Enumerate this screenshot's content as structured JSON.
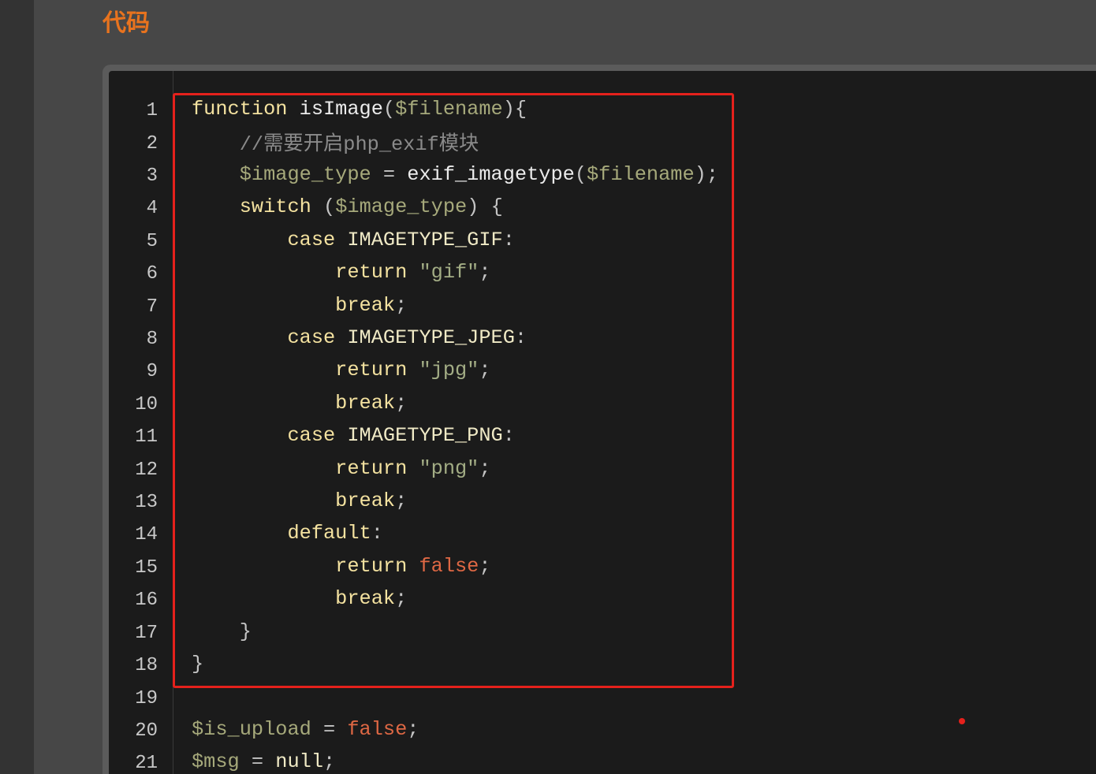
{
  "page": {
    "title": "代码"
  },
  "colors": {
    "title": "#e8731e",
    "highlight": "#e5211c",
    "marker": "#e5211c",
    "line_number": "#c8c8c8",
    "syntax": {
      "keyword": "#f4e2a0",
      "function": "#ececec",
      "variable": "#a6a97b",
      "comment": "#8a8a8a",
      "string": "#a3ad85",
      "constant": "#f0eac6",
      "boolean": "#df6844",
      "punctuation": "#c4c4c4"
    }
  },
  "code": {
    "lines": [
      {
        "num": "1",
        "tokens": [
          {
            "keyword": "function"
          },
          {
            "space": " "
          },
          {
            "function": "isImage"
          },
          {
            "punctuation": "("
          },
          {
            "variable": "$filename"
          },
          {
            "punctuation": "){"
          }
        ]
      },
      {
        "num": "2",
        "tokens": [
          {
            "space": "    "
          },
          {
            "comment": "//需要开启php_exif模块"
          }
        ]
      },
      {
        "num": "3",
        "tokens": [
          {
            "space": "    "
          },
          {
            "variable": "$image_type"
          },
          {
            "punctuation": " = "
          },
          {
            "function": "exif_imagetype"
          },
          {
            "punctuation": "("
          },
          {
            "variable": "$filename"
          },
          {
            "punctuation": ");"
          }
        ]
      },
      {
        "num": "4",
        "tokens": [
          {
            "space": "    "
          },
          {
            "keyword": "switch"
          },
          {
            "punctuation": " ("
          },
          {
            "variable": "$image_type"
          },
          {
            "punctuation": ") {"
          }
        ]
      },
      {
        "num": "5",
        "tokens": [
          {
            "space": "        "
          },
          {
            "keyword": "case"
          },
          {
            "space": " "
          },
          {
            "constant": "IMAGETYPE_GIF"
          },
          {
            "punctuation": ":"
          }
        ]
      },
      {
        "num": "6",
        "tokens": [
          {
            "space": "            "
          },
          {
            "keyword": "return"
          },
          {
            "space": " "
          },
          {
            "string": "\"gif\""
          },
          {
            "punctuation": ";"
          }
        ]
      },
      {
        "num": "7",
        "tokens": [
          {
            "space": "            "
          },
          {
            "keyword": "break"
          },
          {
            "punctuation": ";"
          }
        ]
      },
      {
        "num": "8",
        "tokens": [
          {
            "space": "        "
          },
          {
            "keyword": "case"
          },
          {
            "space": " "
          },
          {
            "constant": "IMAGETYPE_JPEG"
          },
          {
            "punctuation": ":"
          }
        ]
      },
      {
        "num": "9",
        "tokens": [
          {
            "space": "            "
          },
          {
            "keyword": "return"
          },
          {
            "space": " "
          },
          {
            "string": "\"jpg\""
          },
          {
            "punctuation": ";"
          }
        ]
      },
      {
        "num": "10",
        "tokens": [
          {
            "space": "            "
          },
          {
            "keyword": "break"
          },
          {
            "punctuation": ";"
          }
        ]
      },
      {
        "num": "11",
        "tokens": [
          {
            "space": "        "
          },
          {
            "keyword": "case"
          },
          {
            "space": " "
          },
          {
            "constant": "IMAGETYPE_PNG"
          },
          {
            "punctuation": ":"
          }
        ]
      },
      {
        "num": "12",
        "tokens": [
          {
            "space": "            "
          },
          {
            "keyword": "return"
          },
          {
            "space": " "
          },
          {
            "string": "\"png\""
          },
          {
            "punctuation": ";"
          }
        ]
      },
      {
        "num": "13",
        "tokens": [
          {
            "space": "            "
          },
          {
            "keyword": "break"
          },
          {
            "punctuation": ";"
          }
        ]
      },
      {
        "num": "14",
        "tokens": [
          {
            "space": "        "
          },
          {
            "keyword": "default"
          },
          {
            "punctuation": ":"
          }
        ]
      },
      {
        "num": "15",
        "tokens": [
          {
            "space": "            "
          },
          {
            "keyword": "return"
          },
          {
            "space": " "
          },
          {
            "boolean": "false"
          },
          {
            "punctuation": ";"
          }
        ]
      },
      {
        "num": "16",
        "tokens": [
          {
            "space": "            "
          },
          {
            "keyword": "break"
          },
          {
            "punctuation": ";"
          }
        ]
      },
      {
        "num": "17",
        "tokens": [
          {
            "space": "    "
          },
          {
            "punctuation": "}"
          }
        ]
      },
      {
        "num": "18",
        "tokens": [
          {
            "punctuation": "}"
          }
        ]
      },
      {
        "num": "19",
        "tokens": []
      },
      {
        "num": "20",
        "tokens": [
          {
            "variable": "$is_upload"
          },
          {
            "punctuation": " = "
          },
          {
            "boolean": "false"
          },
          {
            "punctuation": ";"
          }
        ]
      },
      {
        "num": "21",
        "tokens": [
          {
            "variable": "$msg"
          },
          {
            "punctuation": " = "
          },
          {
            "constant": "null"
          },
          {
            "punctuation": ";"
          }
        ]
      }
    ]
  }
}
